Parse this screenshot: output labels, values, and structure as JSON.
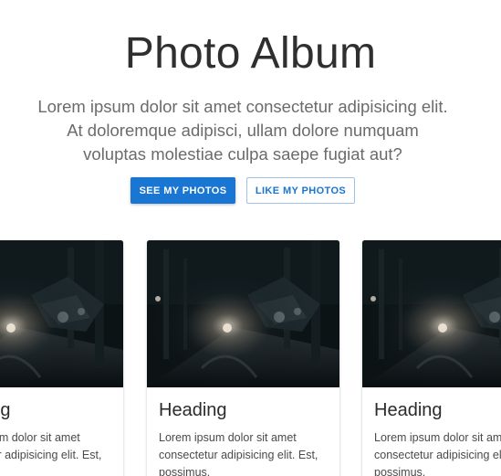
{
  "hero": {
    "title": "Photo Album",
    "text": "Lorem ipsum dolor sit amet consectetur adipisicing elit. At doloremque adipisci, ullam dolore numquam voluptas molestiae culpa saepe fugiat aut?",
    "primary_button": "SEE MY PHOTOS",
    "secondary_button": "LIKE MY PHOTOS"
  },
  "cards": [
    {
      "image": "dark-street-photo",
      "heading": "Heading",
      "text": "Lorem ipsum dolor sit amet consectetur adipisicing elit. Est, possimus."
    },
    {
      "image": "dark-street-photo",
      "heading": "Heading",
      "text": "Lorem ipsum dolor sit amet consectetur adipisicing elit. Est, possimus."
    },
    {
      "image": "dark-street-photo",
      "heading": "Heading",
      "text": "Lorem ipsum dolor sit amet consectetur adipisicing elit. Est, possimus."
    }
  ],
  "colors": {
    "primary": "#1976d2",
    "title": "#2f2f2f",
    "body_text": "#6b6b6b"
  }
}
